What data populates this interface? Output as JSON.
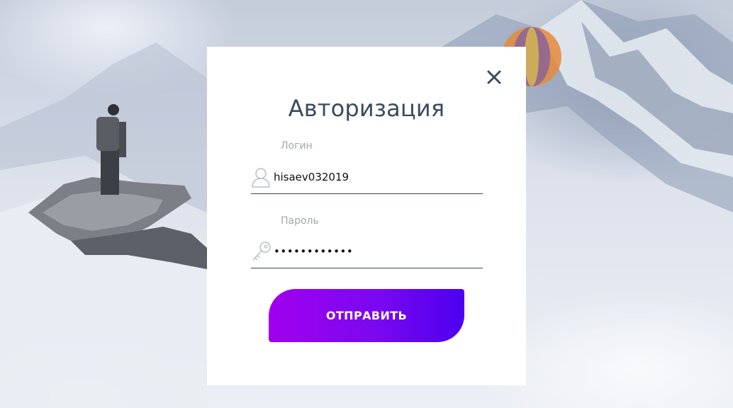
{
  "modal": {
    "title": "Авторизация",
    "close_icon": "close-icon"
  },
  "login": {
    "label": "Логин",
    "value": "hisaev032019",
    "icon": "user-icon"
  },
  "password": {
    "label": "Пароль",
    "value": "************",
    "icon": "key-icon"
  },
  "submit": {
    "label": "ОТПРАВИТЬ"
  },
  "colors": {
    "title": "#3b4a5c",
    "label": "#a0a6ae",
    "button_gradient_start": "#a100ee",
    "button_gradient_end": "#4d00f0"
  }
}
